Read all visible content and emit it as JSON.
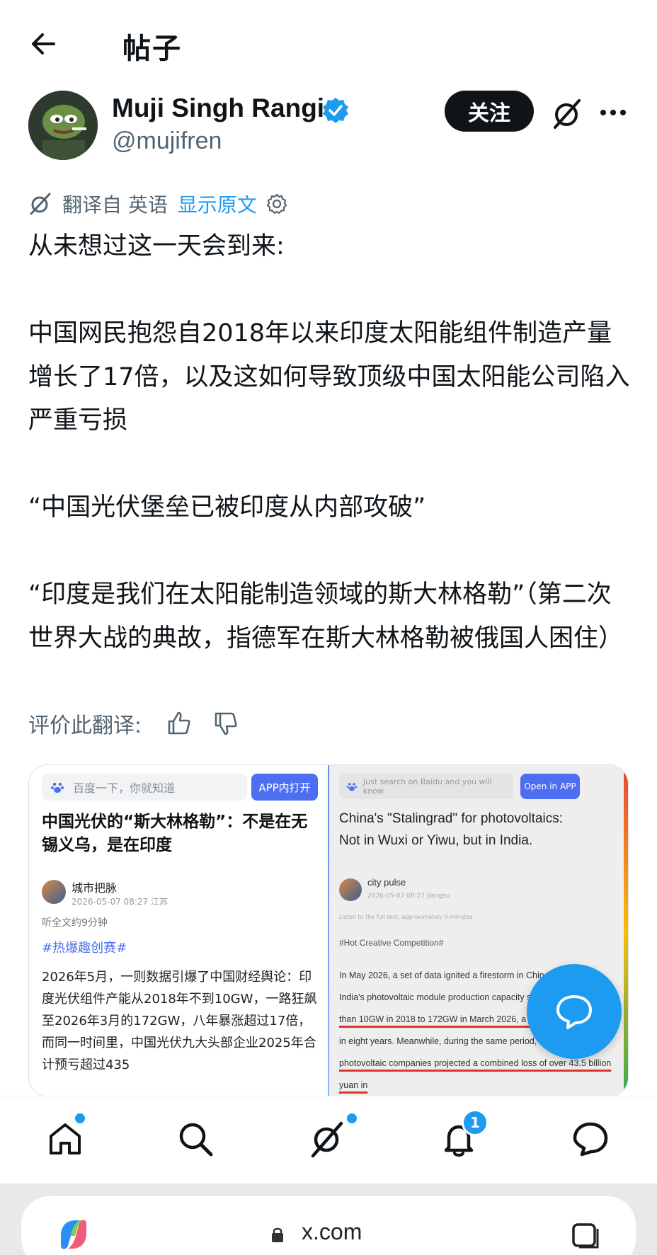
{
  "header": {
    "title": "帖子"
  },
  "author": {
    "name": "Muji Singh Rangi",
    "handle": "@mujifren",
    "follow_label": "关注"
  },
  "translation": {
    "prefix": "翻译自 英语",
    "show_original": "显示原文"
  },
  "post": {
    "paragraphs": [
      "从未想过这一天会到来:",
      "",
      "中国网民抱怨自2018年以来印度太阳能组件制造产量增长了17倍，以及这如何导致顶级中国太阳能公司陷入严重亏损",
      "",
      "“中国光伏堡垒已被印度从内部攻破”",
      "",
      "“印度是我们在太阳能制造领域的斯大林格勒”（第二次世界大战的典故，指德军在斯大林格勒被俄国人困住）"
    ]
  },
  "rate_translation": {
    "label": "评价此翻译:"
  },
  "media": {
    "left": {
      "search_placeholder": "百度一下，你就知道",
      "app_button": "APP内打开",
      "title": "中国光伏的“斯大林格勒”：不是在无锡义乌，是在印度",
      "author_name": "城市把脉",
      "author_meta": "2026-05-07 08:27 江苏",
      "listen": "听全文约9分钟",
      "tag": "#热爆趣创赛#",
      "body": "2026年5月，一则数据引爆了中国财经舆论：印度光伏组件产能从2018年不到10GW，一路狂飙至2026年3月的172GW，八年暴涨超过17倍，而同一时间里，中国光伏九大头部企业2025年合计预亏超过435"
    },
    "right": {
      "search_placeholder": "Just search on Baidu and you will know",
      "app_button": "Open in APP",
      "title": "China's \"Stalingrad\" for photovoltaics: Not in Wuxi or Yiwu, but in India.",
      "author_name": "city pulse",
      "author_meta": "2026-05-07 08:27 Jiangsu",
      "listen": "Listen to the full text, approximately 9 minutes",
      "tag": "#Hot Creative Competition#",
      "body_lines": [
        "In May 2026, a set of data ignited a firestorm in Chinese",
        "India's photovoltaic module production capacity surg",
        "than 10GW in 2018 to 172GW in March 2026, a more t",
        "in eight years. Meanwhile, during the same period, China's",
        "photovoltaic companies projected a combined loss of over 43.5 billion yuan in"
      ]
    }
  },
  "nav": {
    "notification_count": "1"
  },
  "browser": {
    "url": "x.com"
  },
  "colors": {
    "accent": "#1d9bf0",
    "text": "#0f1419",
    "muted": "#536471"
  }
}
